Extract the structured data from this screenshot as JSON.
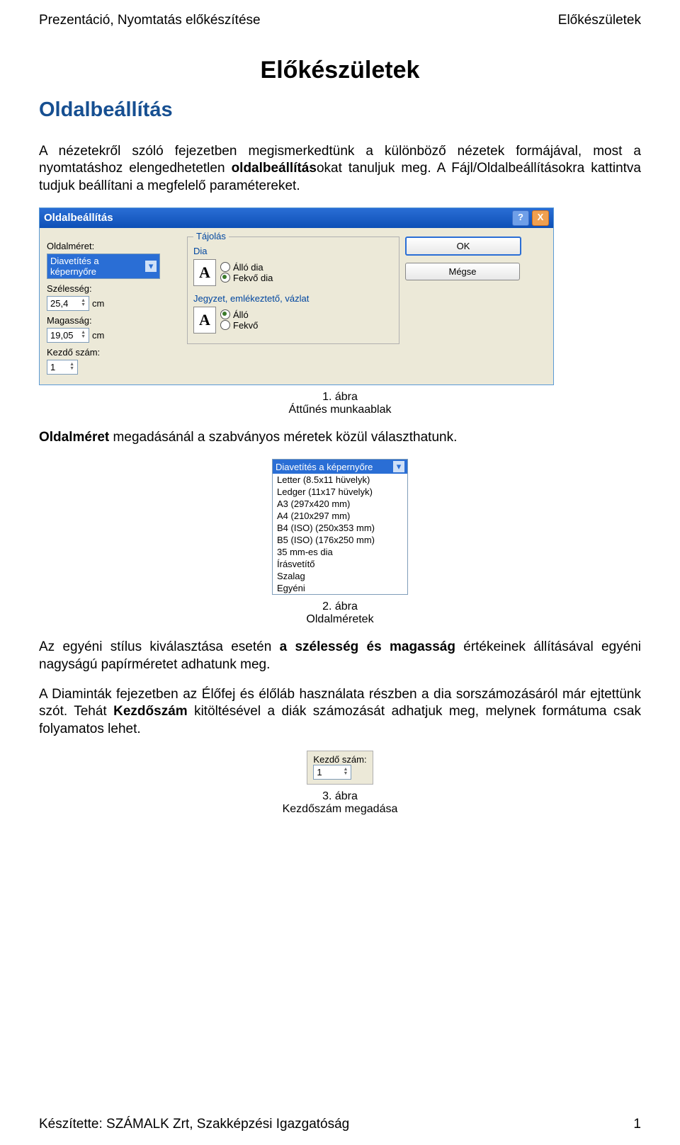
{
  "header": {
    "left": "Prezentáció, Nyomtatás előkészítése",
    "right": "Előkészületek"
  },
  "main_heading": "Előkészületek",
  "section_heading": "Oldalbeállítás",
  "p1_a": "A nézetekről szóló fejezetben megismerkedtünk a különböző nézetek formájával, most a nyomtatáshoz elengedhetetlen ",
  "p1_bold": "oldalbeállítás",
  "p1_b": "okat tanuljuk meg. A Fájl/Oldalbeállításokra kattintva tudjuk beállítani a megfelelő paramétereket.",
  "dlg": {
    "title": "Oldalbeállítás",
    "help": "?",
    "close": "X",
    "lbl_size": "Oldalméret:",
    "combo_size": "Diavetítés a képernyőre",
    "lbl_w": "Szélesség:",
    "val_w": "25,4",
    "unit": "cm",
    "lbl_h": "Magasság:",
    "val_h": "19,05",
    "lbl_start": "Kezdő szám:",
    "val_start": "1",
    "fs1_legend": "Tájolás",
    "fs1_sub": "Dia",
    "fs1_opt1": "Álló dia",
    "fs1_opt2": "Fekvő dia",
    "fs2_sub": "Jegyzet, emlékeztető, vázlat",
    "fs2_opt1": "Álló",
    "fs2_opt2": "Fekvő",
    "btn_ok": "OK",
    "btn_cancel": "Mégse",
    "glyph_A": "A"
  },
  "cap1_a": "1. ábra",
  "cap1_b": "Áttűnés munkaablak",
  "p2_bold": "Oldalméret",
  "p2_a": " megadásánál a szabványos méretek közül választhatunk.",
  "dropdown": {
    "selected": "Diavetítés a képernyőre",
    "items": [
      "Letter (8.5x11 hüvelyk)",
      "Ledger (11x17 hüvelyk)",
      "A3 (297x420 mm)",
      "A4 (210x297 mm)",
      "B4 (ISO) (250x353 mm)",
      "B5 (ISO) (176x250 mm)",
      "35 mm-es dia",
      "Írásvetítő",
      "Szalag",
      "Egyéni"
    ]
  },
  "cap2_a": "2. ábra",
  "cap2_b": "Oldalméretek",
  "p3_a": "Az egyéni stílus kiválasztása esetén ",
  "p3_bold": "a szélesség és magasság",
  "p3_b": " értékeinek állításával egyéni nagyságú papírméretet adhatunk meg.",
  "p4_a": "A Diaminták fejezetben az Élőfej és élőláb használata részben a dia sorszámozásáról már ejtettünk szót. Tehát ",
  "p4_bold": "Kezdőszám",
  "p4_b": " kitöltésével a diák számozását adhatjuk meg, melynek formátuma csak folyamatos lehet.",
  "fig3": {
    "label": "Kezdő szám:",
    "value": "1"
  },
  "cap3_a": "3. ábra",
  "cap3_b": "Kezdőszám megadása",
  "footer": {
    "left": "Készítette: SZÁMALK Zrt, Szakképzési Igazgatóság",
    "right": "1"
  }
}
